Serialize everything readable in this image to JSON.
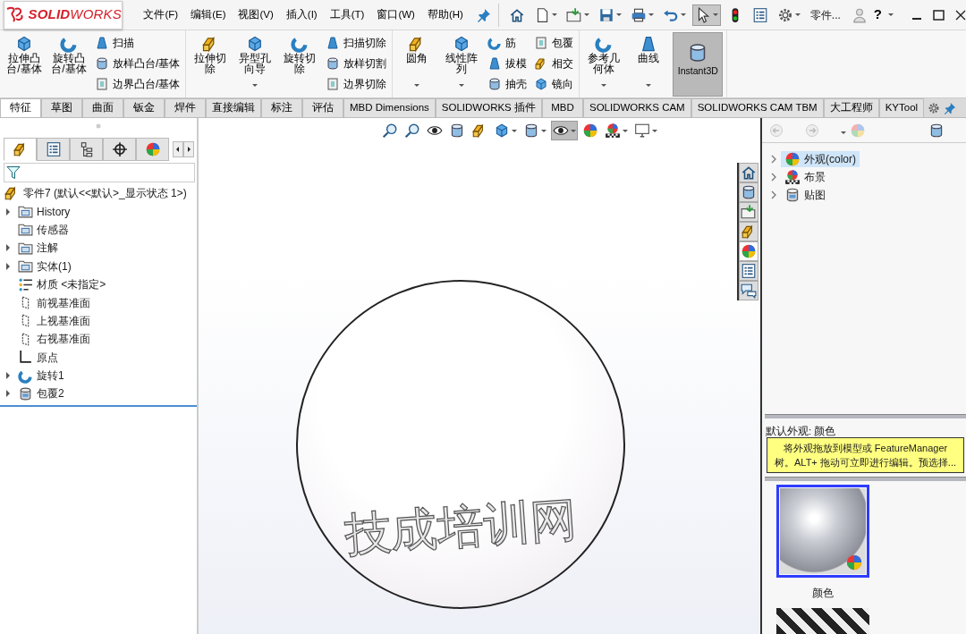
{
  "logo": {
    "text": "**SOLID**WORKS"
  },
  "menu": [
    {
      "label": "文件(F)"
    },
    {
      "label": "编辑(E)"
    },
    {
      "label": "视图(V)"
    },
    {
      "label": "插入(I)"
    },
    {
      "label": "工具(T)"
    },
    {
      "label": "窗口(W)"
    },
    {
      "label": "帮助(H)"
    }
  ],
  "quick_access": [
    {
      "dropdown": false,
      "selected": false
    },
    {
      "dropdown": true,
      "selected": false
    },
    {
      "dropdown": true,
      "selected": false
    },
    {
      "dropdown": true,
      "selected": false
    },
    {
      "dropdown": true,
      "selected": false
    },
    {
      "dropdown": true,
      "selected": false
    },
    {
      "dropdown": true,
      "selected": true
    },
    {
      "dropdown": false,
      "selected": false
    },
    {
      "dropdown": false,
      "selected": false
    },
    {
      "dropdown": true,
      "selected": false
    }
  ],
  "document_title": "零件...",
  "help": "?",
  "ribbon": {
    "groups": [
      {
        "columns": [
          {
            "kind": "large",
            "label": "拉伸凸台/基体",
            "dropdown": false,
            "active": false
          },
          {
            "kind": "large",
            "label": "旋转凸台/基体",
            "dropdown": false,
            "active": false
          },
          {
            "kind": "stack",
            "items": [
              {
                "label": "扫描"
              },
              {
                "label": "放样凸台/基体"
              },
              {
                "label": "边界凸台/基体"
              }
            ]
          }
        ]
      },
      {
        "columns": [
          {
            "kind": "large",
            "label": "拉伸切除",
            "dropdown": false,
            "active": false
          },
          {
            "kind": "large",
            "label": "异型孔向导",
            "dropdown": true,
            "active": false
          },
          {
            "kind": "large",
            "label": "旋转切除",
            "dropdown": false,
            "active": false
          },
          {
            "kind": "stack",
            "items": [
              {
                "label": "扫描切除"
              },
              {
                "label": "放样切割"
              },
              {
                "label": "边界切除"
              }
            ]
          }
        ]
      },
      {
        "columns": [
          {
            "kind": "large",
            "label": "圆角",
            "dropdown": true,
            "active": false
          },
          {
            "kind": "large",
            "label": "线性阵列",
            "dropdown": true,
            "active": false
          },
          {
            "kind": "stack",
            "items": [
              {
                "label": "筋"
              },
              {
                "label": "拔模"
              },
              {
                "label": "抽壳"
              }
            ]
          },
          {
            "kind": "stack",
            "items": [
              {
                "label": "包覆"
              },
              {
                "label": "相交"
              },
              {
                "label": "镜向"
              }
            ]
          }
        ]
      },
      {
        "columns": [
          {
            "kind": "large",
            "label": "参考几何体",
            "dropdown": true,
            "active": false
          },
          {
            "kind": "large",
            "label": "曲线",
            "dropdown": true,
            "active": false
          },
          {
            "kind": "large",
            "label": "Instant3D",
            "dropdown": false,
            "active": true
          }
        ]
      }
    ]
  },
  "tabs": [
    {
      "label": "特征",
      "selected": true
    },
    {
      "label": "草图",
      "selected": false
    },
    {
      "label": "曲面",
      "selected": false
    },
    {
      "label": "钣金",
      "selected": false
    },
    {
      "label": "焊件",
      "selected": false
    },
    {
      "label": "直接编辑",
      "selected": false
    },
    {
      "label": "标注",
      "selected": false
    },
    {
      "label": "评估",
      "selected": false
    },
    {
      "label": "MBD Dimensions",
      "selected": false
    },
    {
      "label": "SOLIDWORKS 插件",
      "selected": false
    },
    {
      "label": "MBD",
      "selected": false
    },
    {
      "label": "SOLIDWORKS CAM",
      "selected": false
    },
    {
      "label": "SOLIDWORKS CAM TBM",
      "selected": false
    },
    {
      "label": "大工程师",
      "selected": false
    },
    {
      "label": "KYTool",
      "selected": false
    }
  ],
  "feature_tree": {
    "panel_tabs": [
      {
        "selected": true
      },
      {
        "selected": false
      },
      {
        "selected": false
      },
      {
        "selected": false
      },
      {
        "selected": false
      }
    ],
    "root": "零件7  (默认<<默认>_显示状态 1>)",
    "items": [
      {
        "label": "History",
        "kind": "folder",
        "expandable": true
      },
      {
        "label": "传感器",
        "kind": "folder",
        "expandable": false
      },
      {
        "label": "注解",
        "kind": "folder",
        "expandable": true
      },
      {
        "label": "实体(1)",
        "kind": "folder",
        "expandable": true
      },
      {
        "label": "材质 <未指定>",
        "kind": "material",
        "expandable": false
      },
      {
        "label": "前视基准面",
        "kind": "plane",
        "expandable": false
      },
      {
        "label": "上视基准面",
        "kind": "plane",
        "expandable": false
      },
      {
        "label": "右视基准面",
        "kind": "plane",
        "expandable": false
      },
      {
        "label": "原点",
        "kind": "origin",
        "expandable": false
      },
      {
        "label": "旋转1",
        "kind": "revolve",
        "expandable": true
      },
      {
        "label": "包覆2",
        "kind": "wrap",
        "expandable": true
      }
    ]
  },
  "viewport": {
    "toolbar": [
      {
        "dropdown": false,
        "selected": false
      },
      {
        "dropdown": false,
        "selected": false
      },
      {
        "dropdown": false,
        "selected": false
      },
      {
        "dropdown": false,
        "selected": false
      },
      {
        "dropdown": false,
        "selected": false
      },
      {
        "dropdown": true,
        "selected": false
      },
      {
        "dropdown": true,
        "selected": false
      },
      {
        "dropdown": true,
        "selected": true
      },
      {
        "dropdown": false,
        "selected": false
      },
      {
        "dropdown": true,
        "selected": false
      },
      {
        "dropdown": true,
        "selected": false
      }
    ],
    "model_text": "技成培训网"
  },
  "side_tabs": [
    {
      "selected": false
    },
    {
      "selected": false
    },
    {
      "selected": false
    },
    {
      "selected": false
    },
    {
      "selected": true
    },
    {
      "selected": false
    },
    {
      "selected": false
    }
  ],
  "task_pane": {
    "tree": [
      {
        "label": "外观(color)",
        "selected": true
      },
      {
        "label": "布景",
        "selected": false
      },
      {
        "label": "贴图",
        "selected": false
      }
    ],
    "caption": "默认外观: 颜色",
    "tooltip": "将外观拖放到模型或 FeatureManager 树。ALT+ 拖动可立即进行编辑。预选择...",
    "swatches": [
      {
        "label": "颜色",
        "selected": true
      },
      {
        "selected": false
      }
    ]
  }
}
